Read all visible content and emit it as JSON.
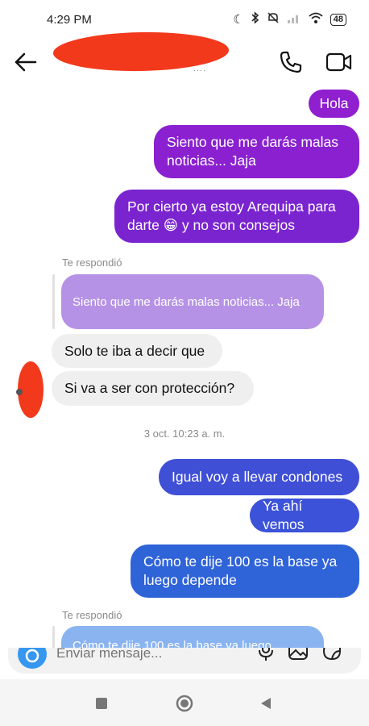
{
  "status_bar": {
    "time": "4:29 PM",
    "battery": "48"
  },
  "messages": [
    {
      "text": "Hola",
      "color": "#8f1fcf"
    },
    {
      "text": "Siento que me darás malas noticias... Jaja",
      "color": "#8a20d0"
    },
    {
      "text": "Por cierto ya estoy Arequipa para darte 😁 y no son consejos",
      "color": "#7a24cf"
    }
  ],
  "reply_1": {
    "label": "Te respondió",
    "quoted": "Siento que me darás malas noticias... Jaja",
    "quoted_color": "#b592e6"
  },
  "incoming": [
    {
      "text": "Solo te iba a decir que"
    },
    {
      "text": "Si va a ser con protección?"
    }
  ],
  "timestamp": "3 oct. 10:23 a. m.",
  "messages_2": [
    {
      "text": "Igual voy a llevar condones",
      "color": "#3f4fd6"
    },
    {
      "text": "Ya ahí vemos",
      "color": "#3b52d9"
    },
    {
      "text": "Cómo te dije 100 es la base ya luego depende",
      "color": "#2f63d8"
    }
  ],
  "reply_2": {
    "label": "Te respondió",
    "quoted": "Cómo te dije 100 es la base ya luego",
    "quoted_color": "#8ab4f0"
  },
  "composer": {
    "placeholder": "Enviar mensaje..."
  }
}
